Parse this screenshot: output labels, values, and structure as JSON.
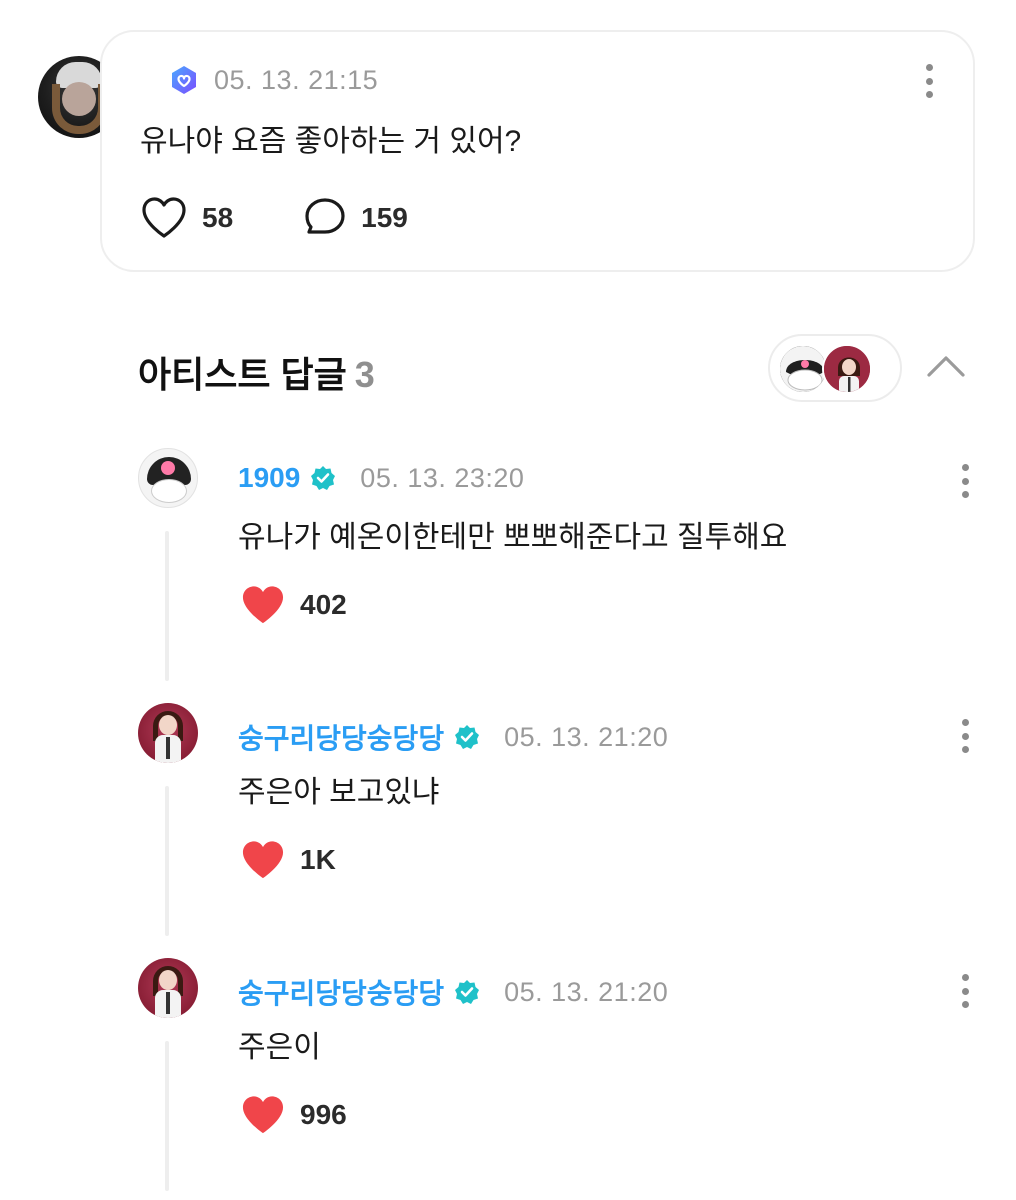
{
  "post": {
    "timestamp": "05. 13. 21:15",
    "text": "유나야 요즘 좋아하는 거 있어?",
    "likes": "58",
    "comments": "159"
  },
  "artist_replies": {
    "title": "아티스트 답글",
    "count": "3"
  },
  "replies": [
    {
      "name": "1909",
      "timestamp": "05. 13. 23:20",
      "text": "유나가 예온이한테만 뽀뽀해준다고 질투해요",
      "likes": "402"
    },
    {
      "name": "숭구리당당숭당당",
      "timestamp": "05. 13. 21:20",
      "text": "주은아 보고있냐",
      "likes": "1K"
    },
    {
      "name": "숭구리당당숭당당",
      "timestamp": "05. 13. 21:20",
      "text": "주은이",
      "likes": "996"
    }
  ],
  "colors": {
    "name_blue": "#2a9df4",
    "verified_teal": "#1fc1c9",
    "heart_red": "#f0454a",
    "fan_badge_purple": "#6a5cf6"
  }
}
